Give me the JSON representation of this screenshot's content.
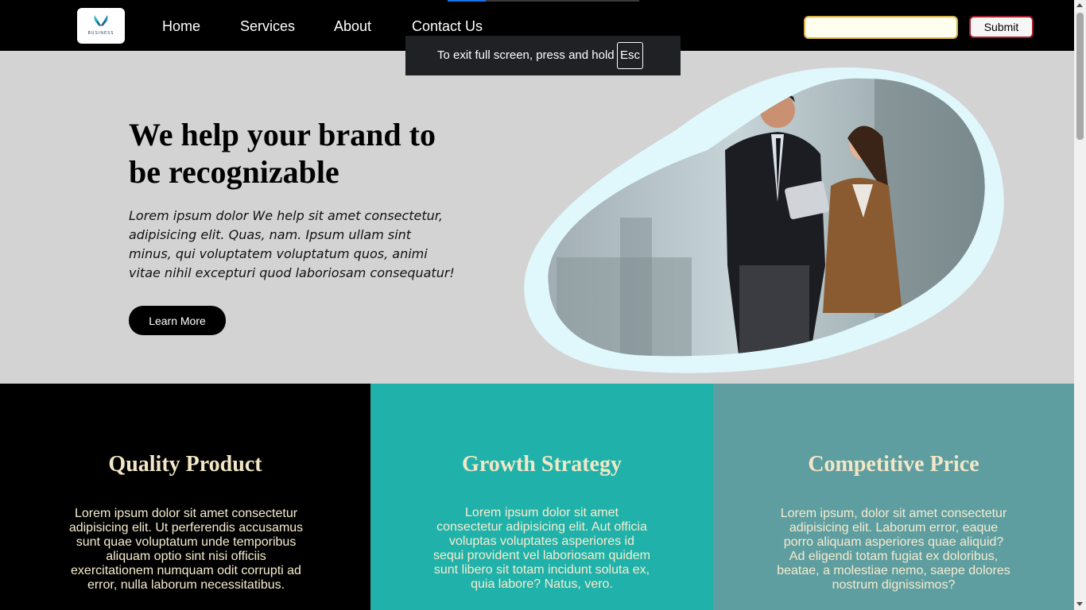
{
  "nav": {
    "logo_text": "BUSINESS",
    "links": [
      "Home",
      "Services",
      "About",
      "Contact Us"
    ],
    "search": {
      "value": "",
      "placeholder": ""
    },
    "submit_label": "Submit"
  },
  "fullscreen_notice": {
    "message": "To exit full screen, press and hold",
    "key": "Esc"
  },
  "hero": {
    "title": "We help your brand to be recognizable",
    "description": "Lorem ipsum dolor We help sit amet consectetur, adipisicing elit. Quas, nam. Ipsum ullam sint minus, qui voluptatem voluptatum quos, animi vitae nihil excepturi quod laboriosam consequatur!",
    "cta_label": "Learn More"
  },
  "features": [
    {
      "title": "Quality Product",
      "text": "Lorem ipsum dolor sit amet consectetur adipisicing elit. Ut perferendis accusamus sunt quae voluptatum unde temporibus aliquam optio sint nisi officiis exercitationem numquam odit corrupti ad error, nulla laborum necessitatibus."
    },
    {
      "title": "Growth Strategy",
      "text": "Lorem ipsum dolor sit amet consectetur adipisicing elit. Aut officia voluptas voluptates asperiores id sequi provident vel laboriosam quidem sunt libero sit totam incidunt soluta ex, quia labore? Natus, vero."
    },
    {
      "title": "Competitive Price",
      "text": "Lorem ipsum, dolor sit amet consectetur adipisicing elit. Laborum error, eaque porro aliquam asperiores quae aliquid? Ad eligendi totam fugiat ex doloribus, beatae, a molestiae nemo, saepe dolores nostrum dignissimos?"
    }
  ],
  "colors": {
    "navbar_bg": "#000000",
    "hero_bg": "#d3d3d3",
    "feature_1_bg": "#000000",
    "feature_2_bg": "#20b2aa",
    "feature_3_bg": "#5f9ea0",
    "feature_text": "#f3e7c6",
    "blob_bg": "#e0f8fc"
  },
  "icons": {
    "logo": "butterfly-logo-icon"
  }
}
